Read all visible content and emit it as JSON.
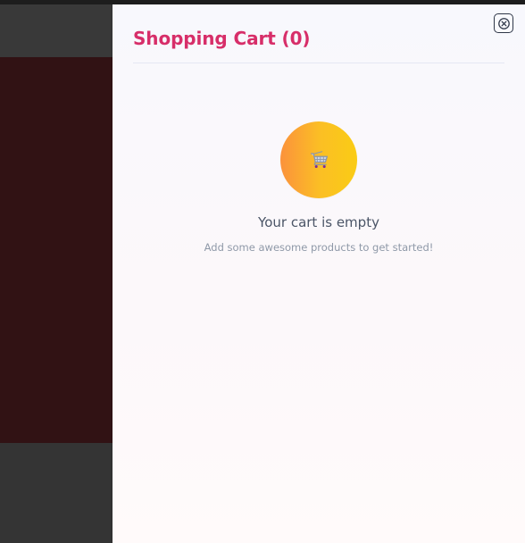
{
  "cart": {
    "title": "Shopping Cart (0)",
    "item_count": 0,
    "close_icon": "close-icon",
    "empty_state": {
      "icon": "shopping-cart-icon",
      "title": "Your cart is empty",
      "subtitle": "Add some awesome products to get started!"
    }
  },
  "colors": {
    "title": "#d72e69",
    "empty_badge_start": "#fb923c",
    "empty_badge_end": "#facc15",
    "drawer_background": "#f8f8fd",
    "background_overlay": "#311214",
    "close_border": "#2f3748",
    "primary_text": "#4b5567",
    "secondary_text": "#8f99a8"
  }
}
